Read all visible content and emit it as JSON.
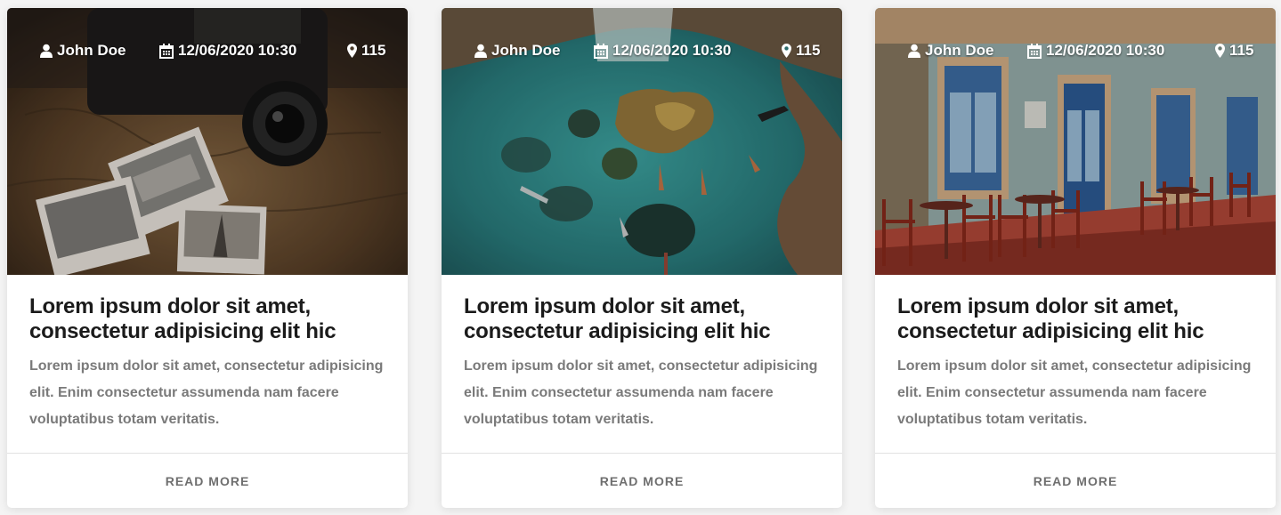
{
  "cards": [
    {
      "image": "vintage camera with polaroid photos on map",
      "meta": {
        "author": "John Doe",
        "date": "12/06/2020 10:30",
        "views": "115"
      },
      "icons": {
        "author": "user-icon",
        "date": "calendar-icon",
        "views": "map-marker-icon"
      },
      "title": "Lorem ipsum dolor sit amet, consectetur adipisicing elit hic",
      "text": "Lorem ipsum dolor sit amet, consectetur adipisicing elit. Enim consectetur assumenda nam facere voluptatibus totam veritatis.",
      "read_more": "READ MORE"
    },
    {
      "image": "aerial view of turquoise lagoon with rocks and boats",
      "meta": {
        "author": "John Doe",
        "date": "12/06/2020 10:30",
        "views": "115"
      },
      "icons": {
        "author": "user-icon",
        "date": "calendar-icon",
        "views": "map-marker-icon"
      },
      "title": "Lorem ipsum dolor sit amet, consectetur adipisicing elit hic",
      "text": "Lorem ipsum dolor sit amet, consectetur adipisicing elit. Enim consectetur assumenda nam facere voluptatibus totam veritatis.",
      "read_more": "READ MORE"
    },
    {
      "image": "colorful street cafe with blue doors and red chairs",
      "meta": {
        "author": "John Doe",
        "date": "12/06/2020 10:30",
        "views": "115"
      },
      "icons": {
        "author": "user-icon",
        "date": "calendar-icon",
        "views": "map-marker-icon"
      },
      "title": "Lorem ipsum dolor sit amet, consectetur adipisicing elit hic",
      "text": "Lorem ipsum dolor sit amet, consectetur adipisicing elit. Enim consectetur assumenda nam facere voluptatibus totam veritatis.",
      "read_more": "READ MORE"
    }
  ],
  "colors": {
    "title": "#1b1b1b",
    "text": "#7a7a7a",
    "read_more": "#6f6f6f",
    "card_bg": "#ffffff",
    "page_bg": "#f4f4f4"
  }
}
